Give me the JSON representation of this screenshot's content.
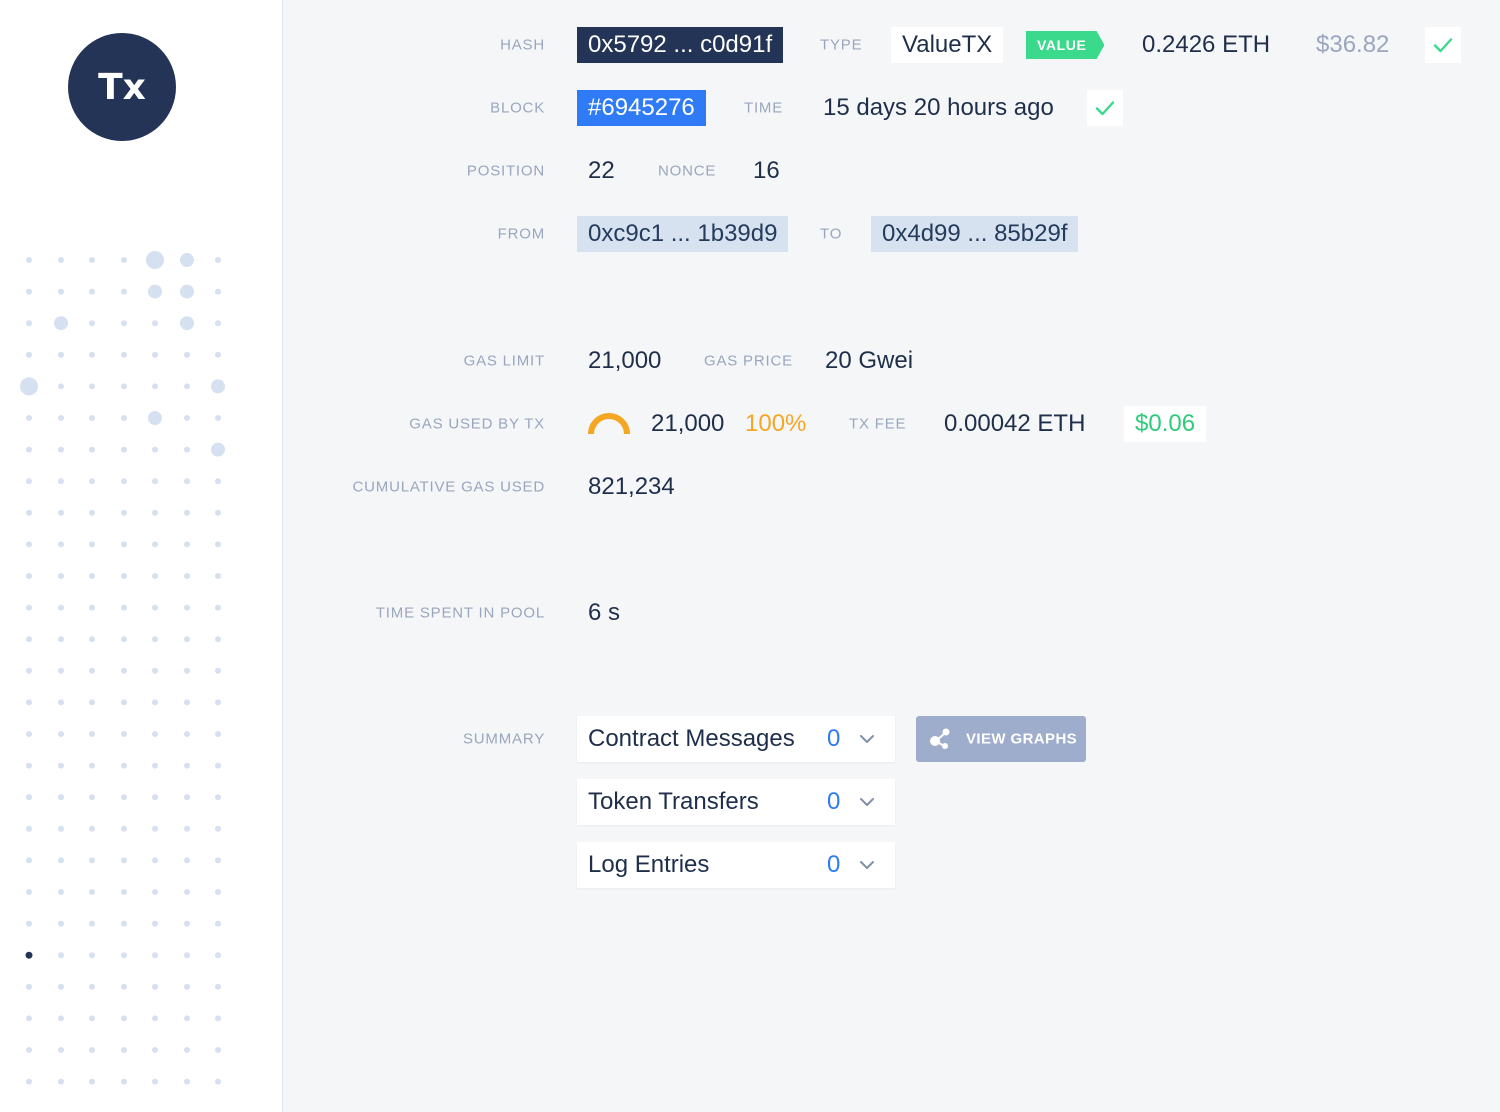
{
  "avatar": {
    "text": "Tx"
  },
  "hash": {
    "label": "HASH",
    "value": "0x5792 ... c0d91f"
  },
  "type": {
    "label": "TYPE",
    "value": "ValueTX"
  },
  "value_tag": "VALUE",
  "value_amount": "0.2426 ETH",
  "value_usd": "$36.82",
  "block": {
    "label": "BLOCK",
    "value": "#6945276"
  },
  "time": {
    "label": "TIME",
    "value": "15 days 20 hours ago"
  },
  "position": {
    "label": "POSITION",
    "value": "22"
  },
  "nonce": {
    "label": "NONCE",
    "value": "16"
  },
  "from": {
    "label": "FROM",
    "value": "0xc9c1 ... 1b39d9"
  },
  "to": {
    "label": "TO",
    "value": "0x4d99 ... 85b29f"
  },
  "gas_limit": {
    "label": "GAS LIMIT",
    "value": "21,000"
  },
  "gas_price": {
    "label": "GAS PRICE",
    "value": "20 Gwei"
  },
  "gas_used": {
    "label": "GAS USED BY TX",
    "value": "21,000",
    "percent": "100%",
    "fill_fraction": 1.0
  },
  "tx_fee": {
    "label": "TX FEE",
    "value": "0.00042 ETH",
    "usd": "$0.06"
  },
  "cumulative_gas": {
    "label": "CUMULATIVE GAS USED",
    "value": "821,234"
  },
  "pool_time": {
    "label": "TIME SPENT IN POOL",
    "value": "6 s"
  },
  "summary": {
    "label": "SUMMARY",
    "items": [
      {
        "label": "Contract Messages",
        "count": "0"
      },
      {
        "label": "Token Transfers",
        "count": "0"
      },
      {
        "label": "Log Entries",
        "count": "0"
      }
    ],
    "view_graphs": "VIEW GRAPHS"
  },
  "colors": {
    "navy": "#243457",
    "blue": "#2f7bf6",
    "green": "#3ad98b",
    "orange": "#f5a623",
    "label_gray": "#9aa6bd",
    "dot": "#d5e0f0"
  },
  "icons": [
    "check-icon",
    "chevron-down-icon",
    "share-graph-icon",
    "gauge-icon"
  ]
}
